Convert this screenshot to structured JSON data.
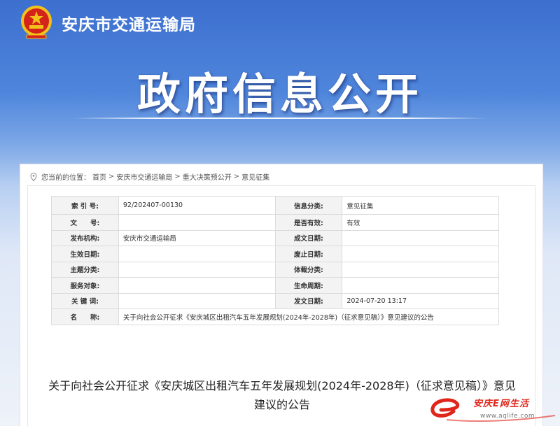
{
  "header": {
    "agency_name": "安庆市交通运输局",
    "banner_title": "政府信息公开"
  },
  "breadcrumb": {
    "prefix": "您当前的位置：",
    "items": [
      "首页",
      "安庆市交通运输局",
      "重大决策预公开",
      "意见征集"
    ],
    "separator": ">"
  },
  "info_table": {
    "rows": [
      {
        "l1": "索 引 号:",
        "v1": "92/202407-00130",
        "l2": "信息分类:",
        "v2": "意见征集"
      },
      {
        "l1": "文　　号:",
        "v1": "",
        "l2": "是否有效:",
        "v2": "有效"
      },
      {
        "l1": "发布机构:",
        "v1": "安庆市交通运输局",
        "l2": "成文日期:",
        "v2": ""
      },
      {
        "l1": "生效日期:",
        "v1": "",
        "l2": "废止日期:",
        "v2": ""
      },
      {
        "l1": "主题分类:",
        "v1": "",
        "l2": "体裁分类:",
        "v2": ""
      },
      {
        "l1": "服务对象:",
        "v1": "",
        "l2": "生命周期:",
        "v2": ""
      },
      {
        "l1": "关 键 词:",
        "v1": "",
        "l2": "发文日期:",
        "v2": "2024-07-20 13:17"
      }
    ],
    "name_label": "名　　称:",
    "name_value": "关于向社会公开征求《安庆城区出租汽车五年发展规划(2024年-2028年)（征求意见稿）》意见建议的公告"
  },
  "article": {
    "title_line1": "关于向社会公开征求《安庆城区出租汽车五年发展规划(2024年-2028年)（征求意见稿）》意见",
    "title_line2": "建议的公告"
  },
  "watermark": {
    "text": "安庆E网生活",
    "url": "www.aqlife.com"
  },
  "colors": {
    "banner_blue": "#3d6fcf",
    "emblem_red": "#d4231a",
    "emblem_gold": "#f2c21b"
  }
}
